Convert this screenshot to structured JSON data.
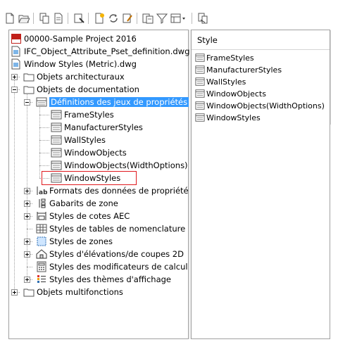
{
  "tree": {
    "project": "00000-Sample Project 2016",
    "file1": "IFC_Object_Attribute_Pset_definition.dwg",
    "file2": "Window Styles (Metric).dwg",
    "arch": "Objets architecturaux",
    "doc": "Objets de documentation",
    "psetdef": "Définitions des jeux de propriétés",
    "pset_items": [
      "FrameStyles",
      "ManufacturerStyles",
      "WallStyles",
      "WindowObjects",
      "WindowObjects(WidthOptions)",
      "WindowStyles"
    ],
    "formats": "Formats des données de propriété",
    "zones_tpl": "Gabarits de zone",
    "dims": "Styles de cotes AEC",
    "sched": "Styles de tables de nomenclature",
    "zones": "Styles de zones",
    "elev": "Styles d'élévations/de coupes 2D",
    "calc": "Styles des modificateurs de calcul",
    "themes": "Styles des thèmes d'affichage",
    "multi": "Objets multifonctions"
  },
  "list": {
    "header": "Style",
    "items": [
      "FrameStyles",
      "ManufacturerStyles",
      "WallStyles",
      "WindowObjects",
      "WindowObjects(WidthOptions)",
      "WindowStyles"
    ]
  }
}
